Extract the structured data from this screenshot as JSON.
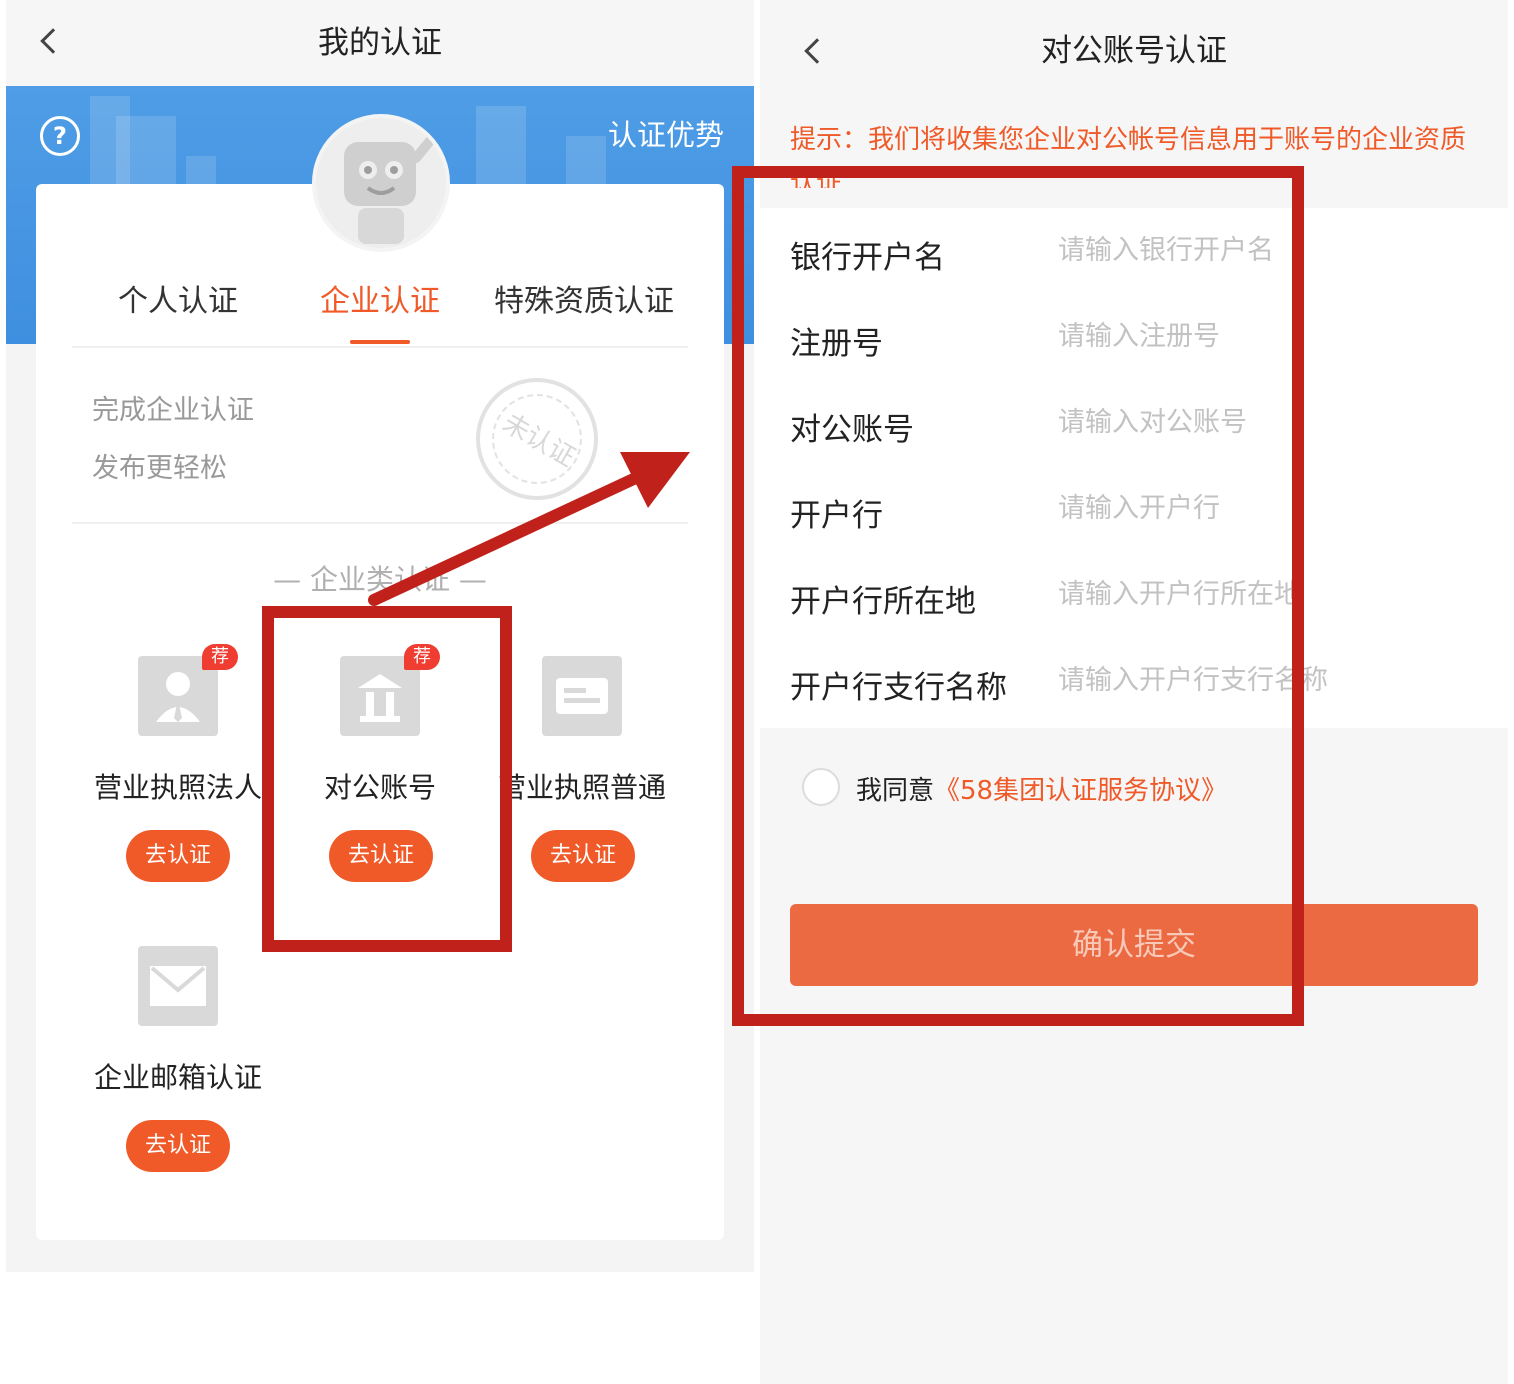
{
  "left": {
    "nav": {
      "title": "我的认证"
    },
    "banner": {
      "advantage_link": "认证优势",
      "help_icon": "?"
    },
    "tabs": [
      {
        "label": "个人认证"
      },
      {
        "label": "企业认证",
        "active": true
      },
      {
        "label": "特殊资质认证"
      }
    ],
    "promo": {
      "line1": "完成企业认证",
      "line2": "发布更轻松",
      "stamp": "未认证"
    },
    "section_title": "— 企业类认证 —",
    "cert_items": [
      {
        "name": "营业执照法人",
        "badge": "荐",
        "button": "去认证",
        "icon": "person-id-icon"
      },
      {
        "name": "对公账号",
        "badge": "荐",
        "button": "去认证",
        "icon": "bank-icon"
      },
      {
        "name": "营业执照普通",
        "button": "去认证",
        "icon": "license-card-icon"
      },
      {
        "name": "企业邮箱认证",
        "button": "去认证",
        "icon": "mail-icon"
      }
    ]
  },
  "right": {
    "nav": {
      "title": "对公账号认证"
    },
    "tip": "提示：我们将收集您企业对公帐号信息用于账号的企业资质认证",
    "fields": [
      {
        "label": "银行开户名",
        "placeholder": "请输入银行开户名"
      },
      {
        "label": "注册号",
        "placeholder": "请输入注册号"
      },
      {
        "label": "对公账号",
        "placeholder": "请输入对公账号"
      },
      {
        "label": "开户行",
        "placeholder": "请输入开户行"
      },
      {
        "label": "开户行所在地",
        "placeholder": "请输入开户行所在地"
      },
      {
        "label": "开户行支行名称",
        "placeholder": "请输入开户行支行名称"
      }
    ],
    "agreement": {
      "prefix": "我同意",
      "link": "《58集团认证服务协议》"
    },
    "submit_label": "确认提交"
  },
  "colors": {
    "accent": "#f05a28",
    "banner_blue": "#4a98e4",
    "annotation_red": "#c0221b",
    "badge_red": "#ef3d32"
  }
}
